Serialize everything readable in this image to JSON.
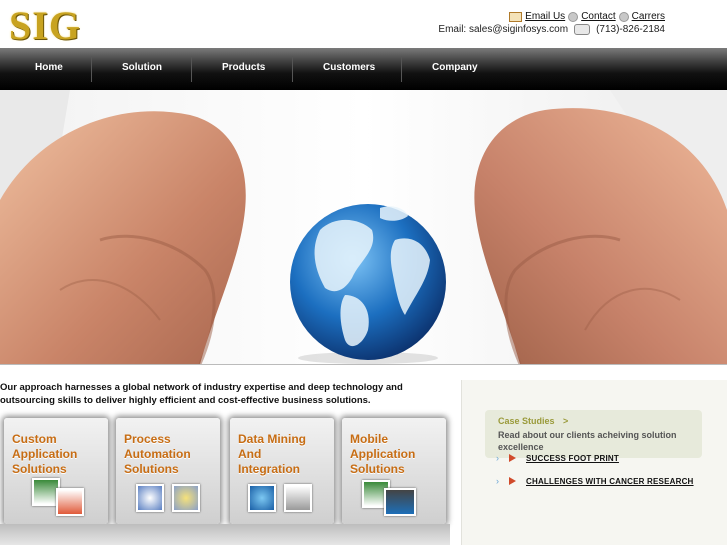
{
  "header": {
    "logo": "SIG",
    "links": [
      "Email Us",
      "Contact",
      "Carrers"
    ],
    "email": "Email: sales@siginfosys.com",
    "phone": "(713)-826-2184"
  },
  "nav": {
    "items": [
      "Home",
      "Solution",
      "Products",
      "Customers",
      "Company"
    ]
  },
  "intro": "Our approach harnesses a global network of industry expertise and deep technology and outsourcing skills to deliver highly efficient and cost-effective business solutions.",
  "tiles": [
    {
      "label": "Custom\nApplication\nSolutions"
    },
    {
      "label": "Process\nAutomation\nSolutions"
    },
    {
      "label": "Data Mining\nAnd\nIntegration"
    },
    {
      "label": "Mobile\nApplication\nSolutions"
    }
  ],
  "case_studies": {
    "title": "Case Studies",
    "arrow": ">",
    "text": "Read about our clients acheiving solution excellence",
    "links": [
      "SUCCESS FOOT PRINT",
      "CHALLENGES WITH CANCER RESEARCH"
    ]
  },
  "colors": {
    "accent_orange": "#c76d14",
    "logo_gold": "#c8a320",
    "nav_bg": "#111111"
  }
}
